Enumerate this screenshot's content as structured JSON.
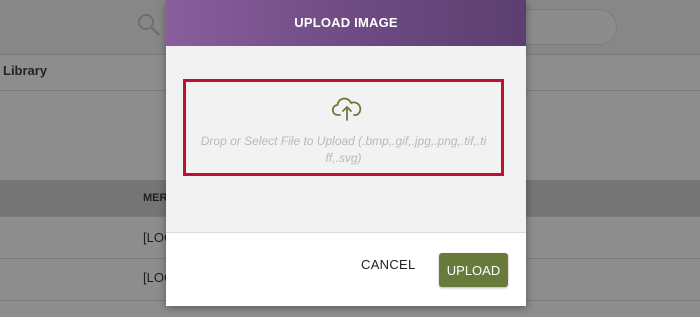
{
  "background": {
    "section_title": "Library",
    "table": {
      "column_header": "MER",
      "rows": [
        "[LOC",
        "[LOC"
      ]
    }
  },
  "modal": {
    "title": "UPLOAD IMAGE",
    "dropzone": {
      "icon": "cloud-upload-icon",
      "text": "Drop or Select File to Upload (.bmp,.gif,.jpg,.png,.tif,.tiff,.svg)"
    },
    "cancel_label": "CANCEL",
    "upload_label": "UPLOAD"
  },
  "colors": {
    "header_start": "#8a5e9c",
    "header_end": "#5c3f70",
    "dropzone_border": "#c0102c",
    "upload_button": "#697b3a",
    "icon_green": "#6b7a3f"
  }
}
